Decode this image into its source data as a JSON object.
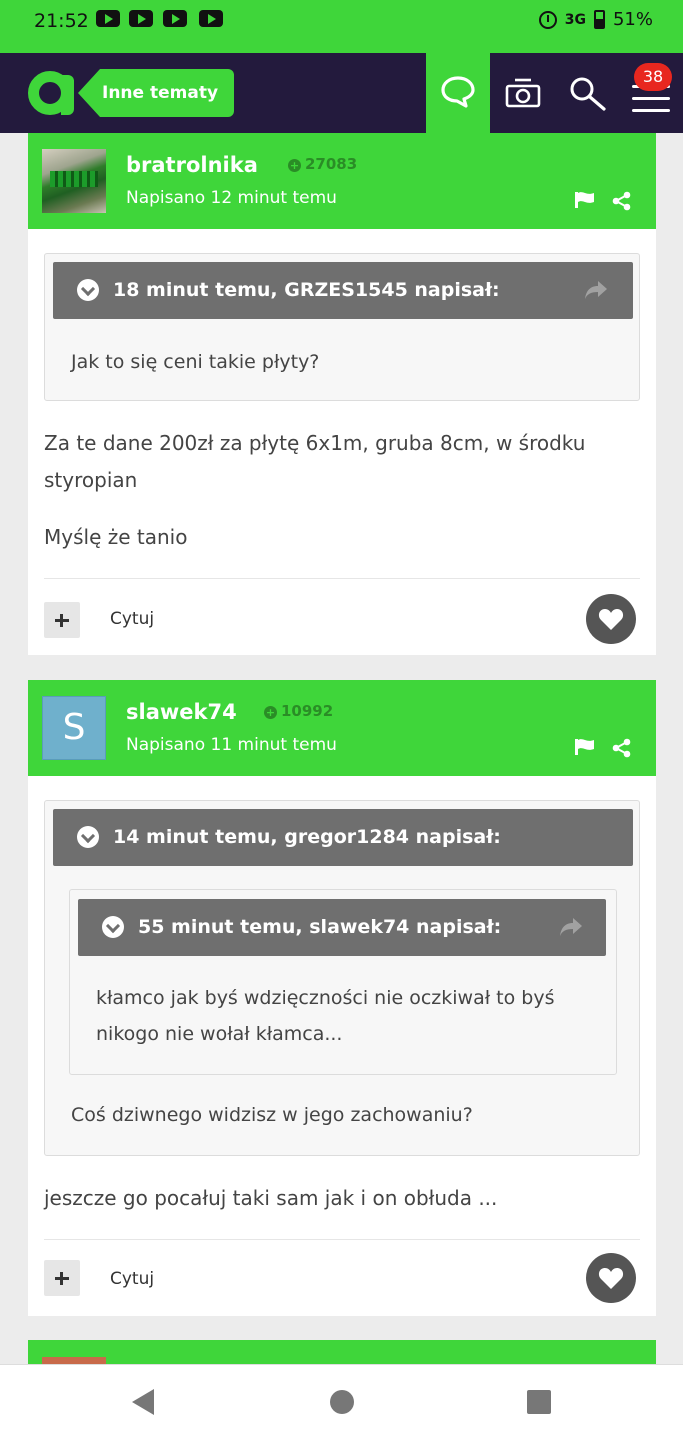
{
  "status_bar": {
    "time": "21:52",
    "network": "3G",
    "battery": "51%"
  },
  "header": {
    "other_topics_label": "Inne tematy",
    "notification_count": "38"
  },
  "posts": [
    {
      "username": "bratrolnika",
      "reputation": "27083",
      "posted": "Napisano 12 minut temu",
      "quote": {
        "header": "18 minut temu, GRZES1545 napisał:",
        "text": "Jak to się ceni takie płyty?"
      },
      "body": [
        "Za te dane 200zł za płytę 6x1m, gruba 8cm, w środku styropian",
        "Myślę że tanio"
      ],
      "quote_label": "Cytuj"
    },
    {
      "username": "slawek74",
      "avatar_letter": "S",
      "reputation": "10992",
      "posted": "Napisano 11 minut temu",
      "quote": {
        "header": "14 minut temu, gregor1284 napisał:",
        "nested": {
          "header": "55 minut temu, slawek74 napisał:",
          "text": "kłamco jak byś wdzięczności nie oczkiwał to byś nikogo nie wołał kłamca..."
        },
        "text": "Coś dziwnego widzisz w jego zachowaniu?"
      },
      "body": [
        "jeszcze go pocałuj taki sam jak i on obłuda ..."
      ],
      "quote_label": "Cytuj"
    }
  ],
  "colors": {
    "brand_green": "#3fd63a",
    "header_dark": "#231a3d",
    "quote_bar": "#6f6f6f",
    "badge_red": "#e8271f"
  },
  "icons": [
    "youtube-icon",
    "alarm-icon",
    "battery-icon",
    "logo",
    "chat-icon",
    "camera-icon",
    "search-icon",
    "menu-icon",
    "flag-icon",
    "share-icon",
    "chevron-down-icon",
    "reply-arrow-icon",
    "plus-icon",
    "heart-icon",
    "back-icon",
    "home-icon",
    "recents-icon"
  ]
}
